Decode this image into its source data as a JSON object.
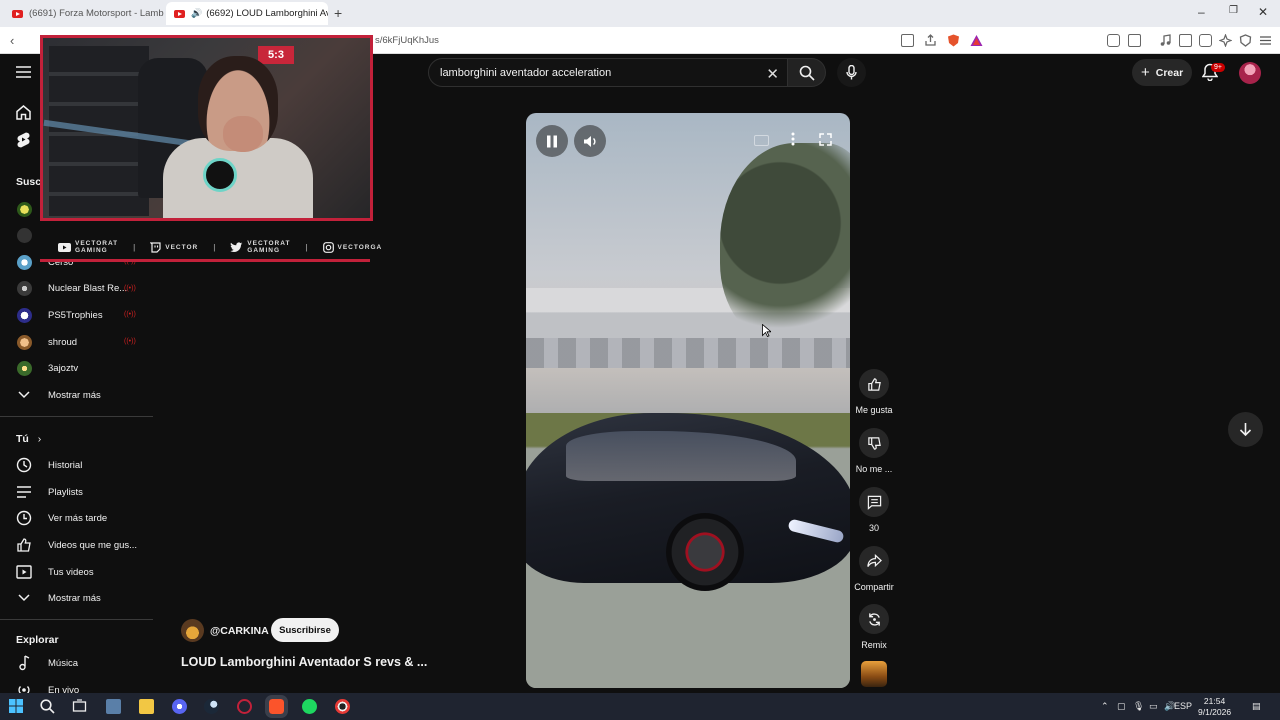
{
  "browser": {
    "tabs": [
      {
        "title": "(6691) Forza Motorsport - Lamborghini",
        "active": false
      },
      {
        "title": "(6692) LOUD Lamborghini Av",
        "active": true
      }
    ],
    "url": "s/6kFjUqKhJus"
  },
  "header": {
    "search_value": "lamborghini aventador acceleration",
    "create_label": "Crear",
    "notifications_badge": "9+"
  },
  "sidebar": {
    "subscriptions_label": "Susc",
    "channels": [
      {
        "name": "Cerso",
        "live": true
      },
      {
        "name": "Nuclear Blast Re...",
        "live": true
      },
      {
        "name": "PS5Trophies",
        "live": true
      },
      {
        "name": "shroud",
        "live": true
      },
      {
        "name": "3ajoztv",
        "live": false
      }
    ],
    "show_more_1": "Mostrar más",
    "you_label": "Tú",
    "you_items": [
      "Historial",
      "Playlists",
      "Ver más tarde",
      "Videos que me gus...",
      "Tus videos"
    ],
    "show_more_2": "Mostrar más",
    "explore_label": "Explorar",
    "explore_items": [
      "Música",
      "En vivo"
    ]
  },
  "overlay": {
    "neon_text": "5:3",
    "socials": [
      {
        "platform": "youtube",
        "line1": "VECTORAT",
        "line2": "GAMING"
      },
      {
        "platform": "twitch",
        "line1": "VECTOR",
        "line2": ""
      },
      {
        "platform": "twitter",
        "line1": "VECTORAT",
        "line2": "GAMING"
      },
      {
        "platform": "instagram",
        "line1": "VECTORGA",
        "line2": ""
      }
    ]
  },
  "actions": {
    "like_label": "Me gusta",
    "dislike_label": "No me ...",
    "comments_count": "30",
    "share_label": "Compartir",
    "remix_label": "Remix"
  },
  "video": {
    "channel": "@CARKINA",
    "subscribe_label": "Suscribirse",
    "title": "LOUD Lamborghini Aventador S revs & ..."
  },
  "taskbar": {
    "language": "ESP",
    "time": "21:54",
    "date": "9/1/2026"
  }
}
